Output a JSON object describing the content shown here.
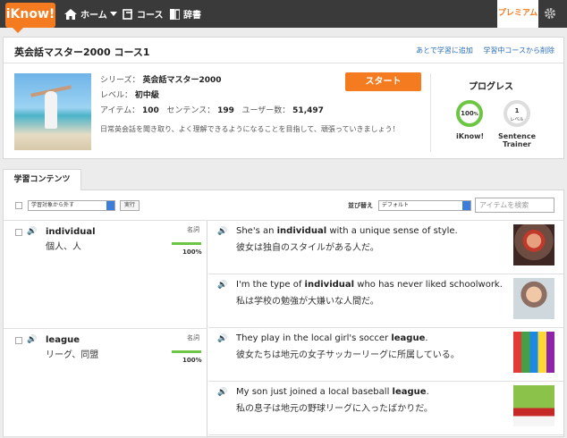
{
  "nav": {
    "logo": "iKnow!",
    "home": "ホーム",
    "course": "コース",
    "dict": "辞書",
    "premium": "プレミアム"
  },
  "course": {
    "title": "英会話マスター2000 コース1",
    "add_link": "あとで学習に追加",
    "remove_link": "学習中コースから削除",
    "series_label": "シリーズ：",
    "series": "英会話マスター2000",
    "level_label": "レベル：",
    "level": "初中級",
    "items_label": "アイテム：",
    "items": "100",
    "sentences_label": "センテンス：",
    "sentences": "199",
    "users_label": "ユーザー数：",
    "users": "51,497",
    "description": "日常英会話を聞き取り、よく理解できるようになることを目指して、頑張っていきましょう！",
    "start": "スタート"
  },
  "progress": {
    "title": "プログレス",
    "iknow_pct_num": "100",
    "iknow_pct_unit": "%",
    "iknow_label": "iKnow!",
    "sentence_level_num": "1",
    "sentence_level_unit": "レベル",
    "sentence_label_1": "Sentence",
    "sentence_label_2": "Trainer",
    "iknow_value": 1.0,
    "sentence_value": 0.1
  },
  "contents": {
    "tab": "学習コンテンツ",
    "filter": "学習対象から外す",
    "run": "実行",
    "sort_label": "並び替え",
    "sort": "デフォルト",
    "search_placeholder": "アイテムを検索"
  },
  "items": [
    {
      "word": "individual",
      "meaning": "個人、人",
      "pos": "名詞",
      "pct": "100%",
      "progress": 1.0
    },
    {
      "word": "league",
      "meaning": "リーグ、同盟",
      "pos": "名詞",
      "pct": "100%",
      "progress": 1.0
    }
  ],
  "sentences": [
    {
      "pre": "She's an ",
      "bold": "individual",
      "post": " with a unique sense of style.",
      "jp": "彼女は独自のスタイルがある人だ。"
    },
    {
      "pre": "I'm the type of ",
      "bold": "individual",
      "post": " who has never liked schoolwork.",
      "jp": "私は学校の勉強が大嫌いな人間だ。"
    },
    {
      "pre": "They play in the local girl's soccer ",
      "bold": "league",
      "post": ".",
      "jp": "彼女たちは地元の女子サッカーリーグに所属している。"
    },
    {
      "pre": "My son just joined a local baseball ",
      "bold": "league",
      "post": ".",
      "jp": "私の息子は地元の野球リーグに入ったばかりだ。"
    }
  ],
  "colors": {
    "accent": "#f47b20",
    "link": "#2a6ebb",
    "progress": "#6cc644",
    "topbar": "#3a3a3a"
  }
}
